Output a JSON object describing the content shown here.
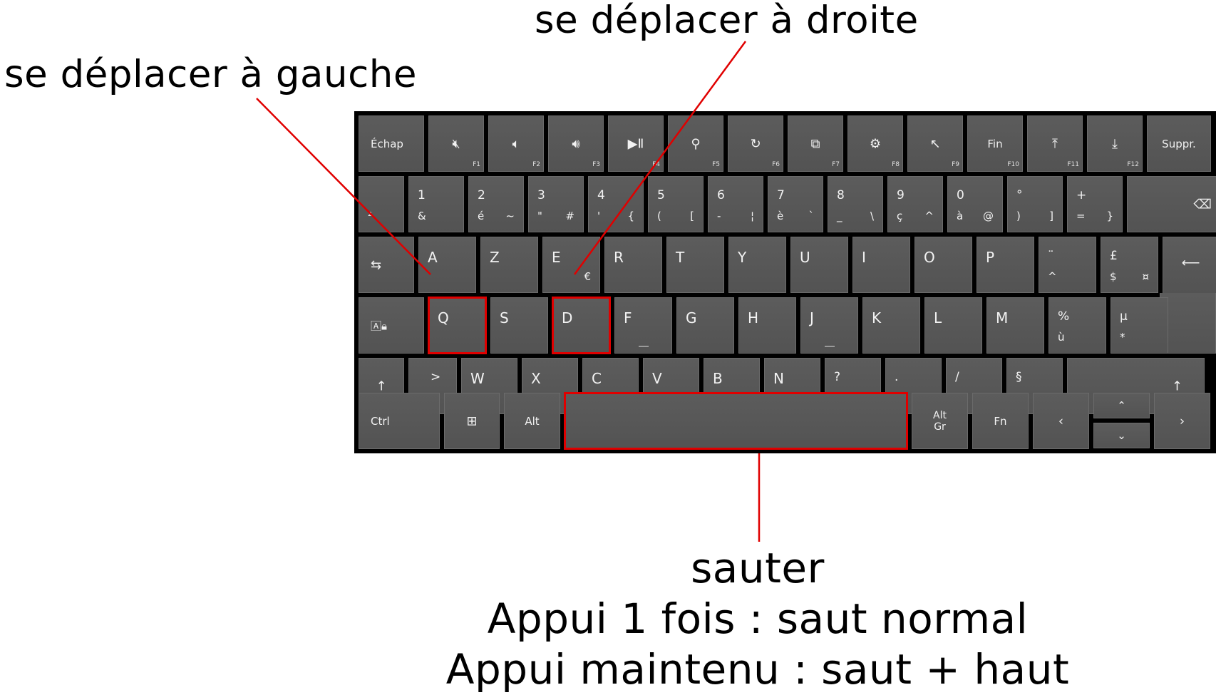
{
  "annotations": {
    "left": "se déplacer à gauche",
    "right": "se déplacer à droite",
    "bottom": [
      "sauter",
      "Appui 1 fois : saut normal",
      "Appui maintenu : saut + haut"
    ]
  },
  "colors": {
    "highlight": "#e00000",
    "key": "#575757",
    "frame": "#000000"
  },
  "keyboard": {
    "row_fn": {
      "esc": "Échap",
      "f1": "F1",
      "f2": "F2",
      "f3": "F3",
      "f4": "F4",
      "f5": "F5",
      "f6": "F6",
      "f7": "F7",
      "f8": "F8",
      "f9": "F9",
      "f10": "F10",
      "f11": "F11",
      "f12": "F12",
      "fin": "Fin",
      "suppr": "Suppr.",
      "icons": [
        "mute-icon",
        "volume-down-icon",
        "volume-up-icon",
        "play-pause-icon",
        "search-icon",
        "sync-icon",
        "screen-icon",
        "gear-icon",
        "arrow-nw-icon",
        "upload-icon",
        "download-icon"
      ]
    },
    "row_num": [
      {
        "bl": "²"
      },
      {
        "tl": "1",
        "bl": "&"
      },
      {
        "tl": "2",
        "bl": "é",
        "br": "~"
      },
      {
        "tl": "3",
        "bl": "\"",
        "br": "#"
      },
      {
        "tl": "4",
        "bl": "'",
        "br": "{"
      },
      {
        "tl": "5",
        "bl": "(",
        "br": "["
      },
      {
        "tl": "6",
        "bl": "-",
        "br": "¦"
      },
      {
        "tl": "7",
        "bl": "è",
        "br": "`"
      },
      {
        "tl": "8",
        "bl": "_",
        "br": "\\"
      },
      {
        "tl": "9",
        "bl": "ç",
        "br": "^"
      },
      {
        "tl": "0",
        "bl": "à",
        "br": "@"
      },
      {
        "tl": "°",
        "bl": ")",
        "br": "]"
      },
      {
        "tl": "+",
        "bl": "=",
        "br": "}"
      }
    ],
    "row_azerty": [
      "A",
      "Z",
      "E",
      "R",
      "T",
      "Y",
      "U",
      "I",
      "O",
      "P"
    ],
    "row_azerty_extra": {
      "e_alt": "€",
      "dia_tl": "¨",
      "dia_bl": "^",
      "pound_tl": "£",
      "pound_bl": "$",
      "pound_br": "¤"
    },
    "row_qsdf": [
      "Q",
      "S",
      "D",
      "F",
      "G",
      "H",
      "J",
      "K",
      "L",
      "M"
    ],
    "row_qsdf_extra": {
      "pct_tl": "%",
      "pct_bl": "ù",
      "mu_tl": "µ",
      "mu_bl": "*"
    },
    "row_wxcv": [
      "W",
      "X",
      "C",
      "V",
      "B",
      "N"
    ],
    "row_wxcv_extra": {
      "lt_tl": ">",
      "lt_bl": "<",
      "q_tl": "?",
      "q_bl": ",",
      "dot_tl": ".",
      "dot_bl": ";",
      "sl_tl": "/",
      "sl_bl": ":",
      "sec_tl": "§",
      "sec_bl": "!"
    },
    "row_bottom": {
      "ctrl": "Ctrl",
      "alt": "Alt",
      "altgr_1": "Alt",
      "altgr_2": "Gr",
      "fn": "Fn"
    }
  }
}
